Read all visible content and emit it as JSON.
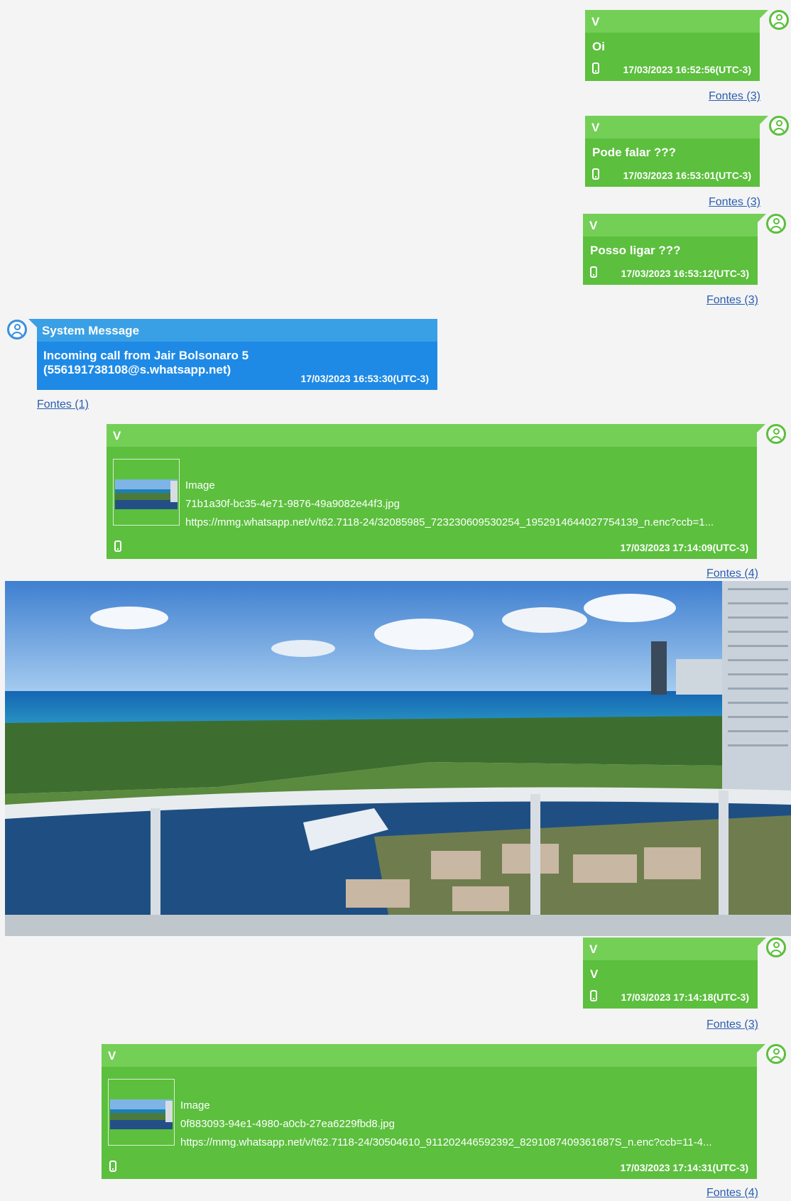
{
  "messages": [
    {
      "sender": "V",
      "text": "Oi",
      "timestamp": "17/03/2023 16:52:56(UTC-3)",
      "sources": "Fontes (3)"
    },
    {
      "sender": "V",
      "text": "Pode falar  ???",
      "timestamp": "17/03/2023 16:53:01(UTC-3)",
      "sources": "Fontes (3)"
    },
    {
      "sender": "V",
      "text": "Posso ligar  ???",
      "timestamp": "17/03/2023 16:53:12(UTC-3)",
      "sources": "Fontes (3)"
    }
  ],
  "system_message": {
    "title": "System Message",
    "text": "Incoming call from Jair Bolsonaro 5 (556191738108@s.whatsapp.net)",
    "timestamp": "17/03/2023 16:53:30(UTC-3)",
    "sources": "Fontes (1)"
  },
  "image_message_1": {
    "sender": "V",
    "label": "Image",
    "filename": "71b1a30f-bc35-4e71-9876-49a9082e44f3.jpg",
    "url": "https://mmg.whatsapp.net/v/t62.7118-24/32085985_723230609530254_1952914644027754139_n.enc?ccb=1...",
    "timestamp": "17/03/2023 17:14:09(UTC-3)",
    "sources": "Fontes (4)"
  },
  "message_4": {
    "sender": "V",
    "text": "V",
    "timestamp": "17/03/2023 17:14:18(UTC-3)",
    "sources": "Fontes (3)"
  },
  "image_message_2": {
    "sender": "V",
    "label": "Image",
    "filename": "0f883093-94e1-4980-a0cb-27ea6229fbd8.jpg",
    "url": "https://mmg.whatsapp.net/v/t62.7118-24/30504610_911202446592392_8291087409361687S_n.enc?ccb=11-4...",
    "timestamp": "17/03/2023 17:14:31(UTC-3)",
    "sources": "Fontes (4)"
  },
  "colors": {
    "bubble_green": "#5cbf3e",
    "header_green": "#74cf57",
    "system_blue": "#1e8ae6",
    "link_blue": "#2a5db0"
  },
  "icons": [
    "user-avatar-icon",
    "phone-device-icon"
  ]
}
